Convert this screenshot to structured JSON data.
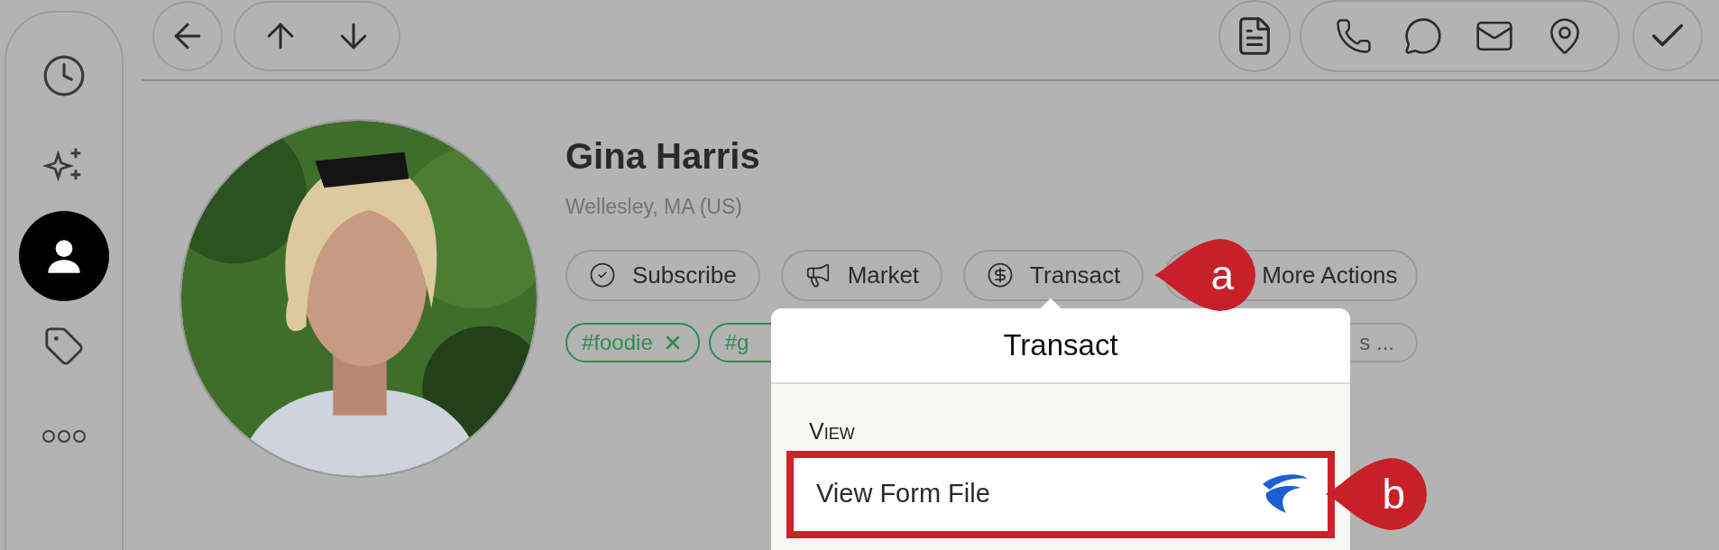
{
  "sidebar": {
    "items": [
      {
        "kind": "history",
        "selected": false
      },
      {
        "kind": "suggestions",
        "selected": false
      },
      {
        "kind": "contact",
        "selected": true
      },
      {
        "kind": "tags",
        "selected": false
      },
      {
        "kind": "more",
        "selected": false
      }
    ]
  },
  "profile": {
    "name": "Gina Harris",
    "location": "Wellesley, MA (US)"
  },
  "actions": [
    {
      "kind": "subscribe",
      "label": "Subscribe"
    },
    {
      "kind": "market",
      "label": "Market"
    },
    {
      "kind": "transact",
      "label": "Transact"
    },
    {
      "kind": "more",
      "label": "More Actions"
    }
  ],
  "tags": [
    {
      "label": "#foodie",
      "removable": true
    },
    {
      "label": "#g",
      "removable": false
    },
    {
      "label": "s ...",
      "removable": false
    }
  ],
  "popup": {
    "title": "Transact",
    "sections": [
      {
        "heading": "View",
        "items": [
          {
            "label": "View Form File",
            "highlighted": true
          }
        ]
      }
    ]
  },
  "callouts": [
    {
      "label": "a"
    },
    {
      "label": "b"
    }
  ]
}
